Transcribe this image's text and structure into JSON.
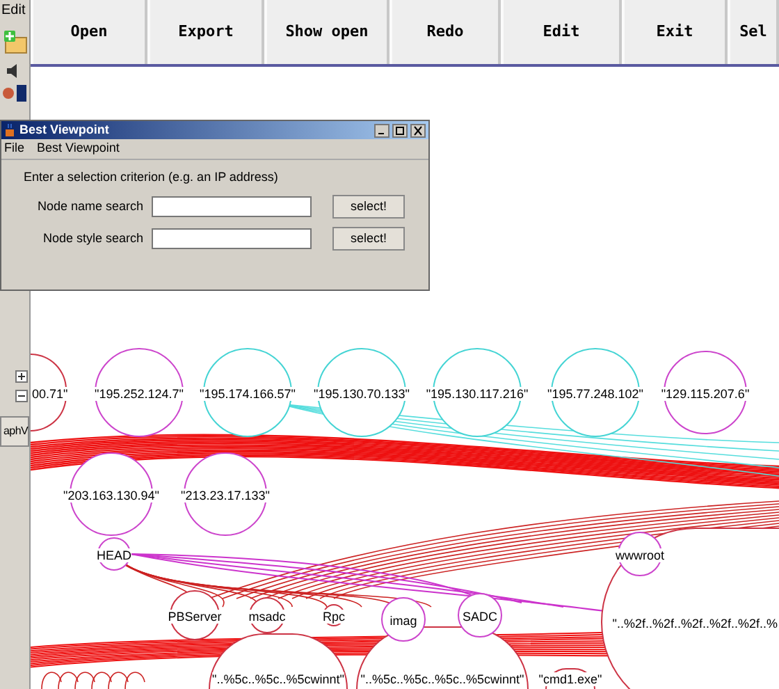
{
  "side_panel": {
    "menu_label": "Edit",
    "tab_label": "aphV"
  },
  "toolbar": {
    "buttons": [
      "Open",
      "Export",
      "Show open",
      "Redo",
      "Edit",
      "Exit",
      "Sel"
    ]
  },
  "dialog": {
    "title": "Best Viewpoint",
    "menu": [
      "File",
      "Best Viewpoint"
    ],
    "instruction": "Enter a selection criterion (e.g. an IP address)",
    "rows": [
      {
        "label": "Node name search",
        "button": "select!"
      },
      {
        "label": "Node style search",
        "button": "select!"
      }
    ]
  },
  "graph": {
    "nodes": [
      {
        "label": "00.71\"",
        "color": "#cc3344"
      },
      {
        "label": "\"195.252.124.7\"",
        "color": "#cc44cc"
      },
      {
        "label": "\"195.174.166.57\"",
        "color": "#44d4d4"
      },
      {
        "label": "\"195.130.70.133\"",
        "color": "#44d4d4"
      },
      {
        "label": "\"195.130.117.216\"",
        "color": "#44d4d4"
      },
      {
        "label": "\"195.77.248.102\"",
        "color": "#44d4d4"
      },
      {
        "label": "\"129.115.207.6\"",
        "color": "#cc44cc"
      },
      {
        "label": "\"203.163.130.94\"",
        "color": "#cc44cc"
      },
      {
        "label": "\"213.23.17.133\"",
        "color": "#cc44cc"
      },
      {
        "label": "HEAD",
        "color": "#cc44cc"
      },
      {
        "label": "wwwroot",
        "color": "#cc44cc"
      },
      {
        "label": "PBServer",
        "color": "#cc3344"
      },
      {
        "label": "msadc",
        "color": "#cc3344"
      },
      {
        "label": "Rpc",
        "color": "#cc3344"
      },
      {
        "label": "imag",
        "color": "#cc44cc"
      },
      {
        "label": "SADC",
        "color": "#cc44cc"
      },
      {
        "label": "\"..%2f..%2f..%2f..%2f..%2f..%",
        "color": "#cc3344"
      },
      {
        "label": "\"..%5c..%5c..%5cwinnt\"",
        "color": "#cc3344"
      },
      {
        "label": "\"..%5c..%5c..%5c..%5cwinnt\"",
        "color": "#cc3344"
      },
      {
        "label": "\"cmd1.exe\"",
        "color": "#cc3344"
      }
    ]
  }
}
